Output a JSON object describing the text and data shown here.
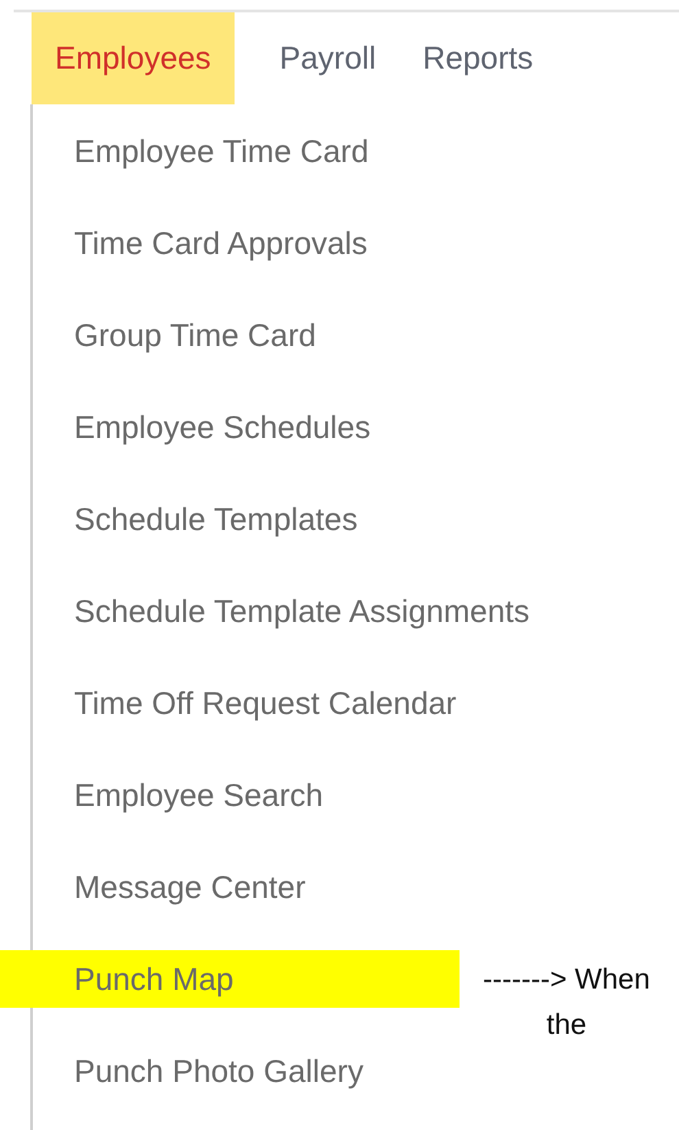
{
  "nav_tabs": [
    {
      "label": "Employees",
      "selected": true
    },
    {
      "label": "Payroll",
      "selected": false
    },
    {
      "label": "Reports",
      "selected": false
    }
  ],
  "menu_items": [
    {
      "label": "Employee Time Card",
      "highlighted": false
    },
    {
      "label": "Time Card Approvals",
      "highlighted": false
    },
    {
      "label": "Group Time Card",
      "highlighted": false
    },
    {
      "label": "Employee Schedules",
      "highlighted": false
    },
    {
      "label": "Schedule Templates",
      "highlighted": false
    },
    {
      "label": "Schedule Template Assignments",
      "highlighted": false
    },
    {
      "label": "Time Off Request Calendar",
      "highlighted": false
    },
    {
      "label": "Employee Search",
      "highlighted": false
    },
    {
      "label": "Message Center",
      "highlighted": false
    },
    {
      "label": "Punch Map",
      "highlighted": true,
      "annotation": [
        "------->  When",
        "the"
      ]
    },
    {
      "label": "Punch Photo Gallery",
      "highlighted": false
    }
  ]
}
